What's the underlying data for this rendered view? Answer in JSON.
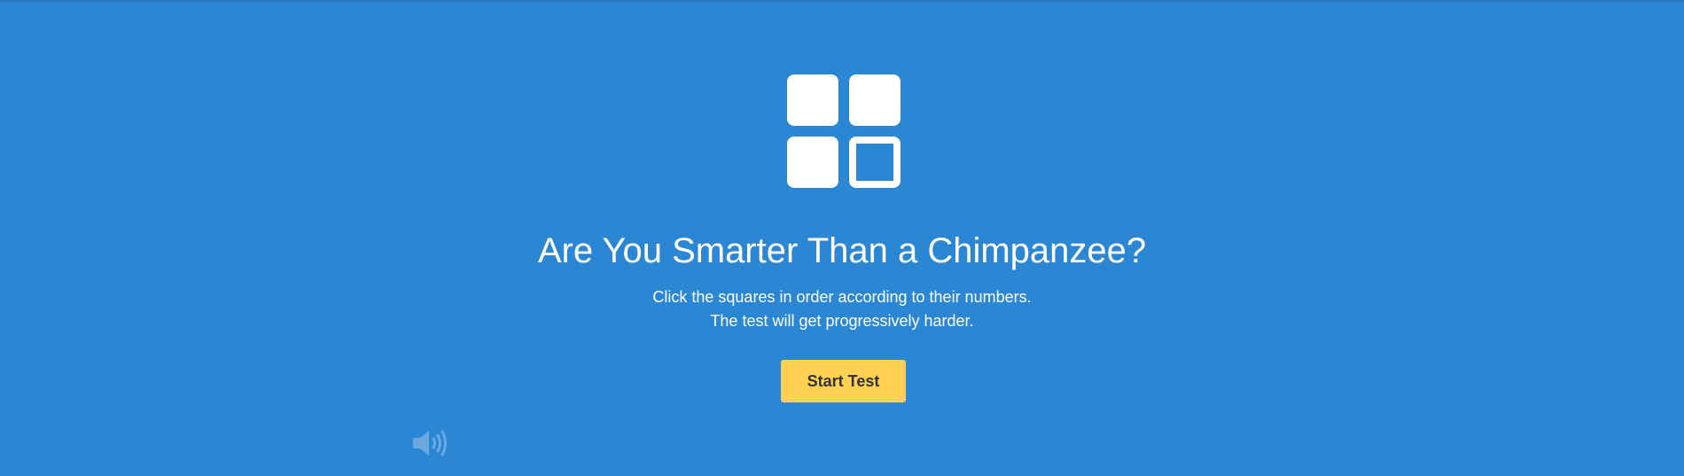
{
  "page": {
    "background_color": "#2b87d3",
    "accent_color": "#ffd152"
  },
  "logo": {
    "icon": "squares-grid-icon"
  },
  "content": {
    "title": "Are You Smarter Than a Chimpanzee?",
    "subtitle_line1": "Click the squares in order according to their numbers.",
    "subtitle_line2": "The test will get progressively harder."
  },
  "actions": {
    "start_label": "Start Test"
  },
  "controls": {
    "sound_icon": "volume-icon"
  }
}
